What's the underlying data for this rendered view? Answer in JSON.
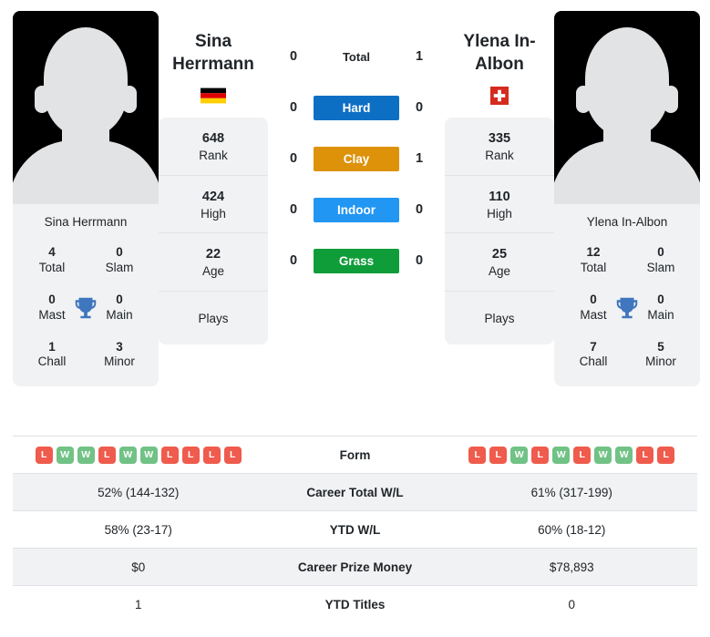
{
  "players": {
    "left": {
      "name": "Sina Herrmann",
      "name_line1": "Sina",
      "name_line2": "Herrmann",
      "photo_name": "Sina Herrmann",
      "flag": "germany-flag",
      "stats": [
        {
          "value": "648",
          "label": "Rank"
        },
        {
          "value": "424",
          "label": "High"
        },
        {
          "value": "22",
          "label": "Age"
        }
      ],
      "plays_label": "Plays",
      "plays_value": "",
      "titles": [
        {
          "value": "4",
          "label": "Total"
        },
        {
          "value": "0",
          "label": "Slam"
        },
        {
          "value": "0",
          "label": "Mast"
        },
        {
          "value": "0",
          "label": "Main"
        },
        {
          "value": "1",
          "label": "Chall"
        },
        {
          "value": "3",
          "label": "Minor"
        }
      ],
      "form": [
        "L",
        "W",
        "W",
        "L",
        "W",
        "W",
        "L",
        "L",
        "L",
        "L"
      ]
    },
    "right": {
      "name": "Ylena In-Albon",
      "name_line1": "Ylena In-",
      "name_line2": "Albon",
      "photo_name": "Ylena In-Albon",
      "flag": "switzerland-flag",
      "stats": [
        {
          "value": "335",
          "label": "Rank"
        },
        {
          "value": "110",
          "label": "High"
        },
        {
          "value": "25",
          "label": "Age"
        }
      ],
      "plays_label": "Plays",
      "plays_value": "",
      "titles": [
        {
          "value": "12",
          "label": "Total"
        },
        {
          "value": "0",
          "label": "Slam"
        },
        {
          "value": "0",
          "label": "Mast"
        },
        {
          "value": "0",
          "label": "Main"
        },
        {
          "value": "7",
          "label": "Chall"
        },
        {
          "value": "5",
          "label": "Minor"
        }
      ],
      "form": [
        "L",
        "L",
        "W",
        "L",
        "W",
        "L",
        "W",
        "W",
        "L",
        "L"
      ]
    }
  },
  "head_to_head": [
    {
      "label": "Total",
      "left": "0",
      "right": "1",
      "color": "",
      "plain": true
    },
    {
      "label": "Hard",
      "left": "0",
      "right": "0",
      "color": "#0d6fc4",
      "plain": false
    },
    {
      "label": "Clay",
      "left": "0",
      "right": "1",
      "color": "#dd9209",
      "plain": false
    },
    {
      "label": "Indoor",
      "left": "0",
      "right": "0",
      "color": "#2196f3",
      "plain": false
    },
    {
      "label": "Grass",
      "left": "0",
      "right": "0",
      "color": "#0f9d3a",
      "plain": false
    }
  ],
  "comparison_rows": [
    {
      "label": "Form",
      "left": "",
      "right": "",
      "type": "form"
    },
    {
      "label": "Career Total W/L",
      "left": "52% (144-132)",
      "right": "61% (317-199)",
      "type": "text"
    },
    {
      "label": "YTD W/L",
      "left": "58% (23-17)",
      "right": "60% (18-12)",
      "type": "text"
    },
    {
      "label": "Career Prize Money",
      "left": "$0",
      "right": "$78,893",
      "type": "text"
    },
    {
      "label": "YTD Titles",
      "left": "1",
      "right": "0",
      "type": "text"
    }
  ],
  "colors": {
    "hard": "#0d6fc4",
    "clay": "#dd9209",
    "indoor": "#2196f3",
    "grass": "#0f9d3a",
    "win": "#71c285",
    "loss": "#ef5b4c",
    "trophy": "#3f76bd",
    "card_bg": "#f1f2f3"
  },
  "icons": {
    "trophy": "trophy-icon"
  }
}
